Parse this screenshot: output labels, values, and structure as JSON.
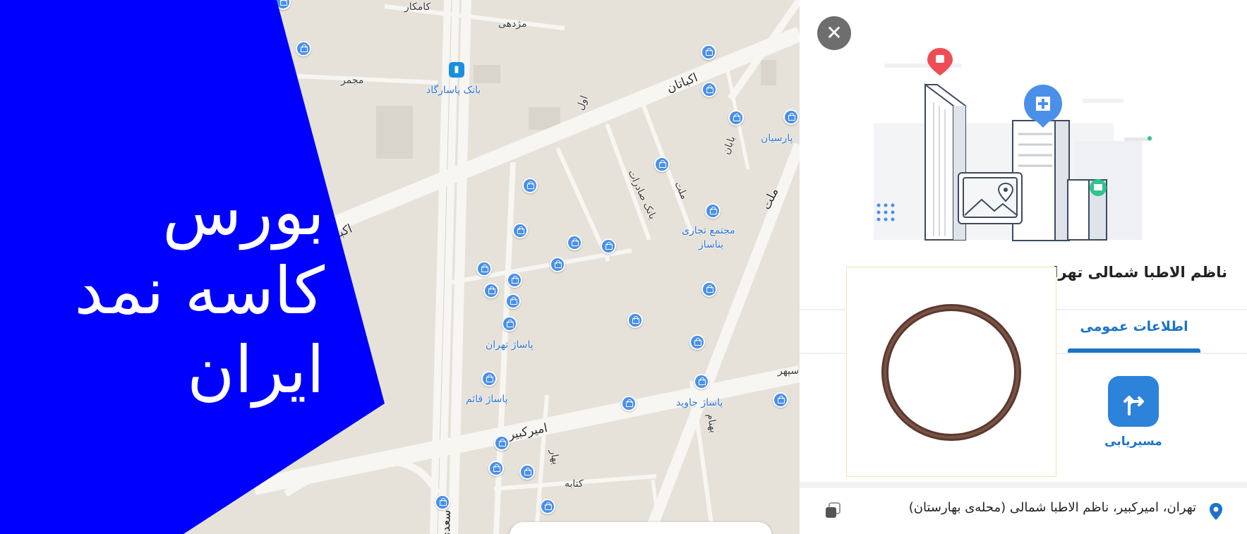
{
  "overlay": {
    "line1": "بورس",
    "line2": "کاسه نمد",
    "line3": "ایران",
    "color": "#0000ff"
  },
  "map": {
    "labels": {
      "kamkar": "کامکار",
      "mojdehi": "مژدهی",
      "mojammar": "مجمر",
      "bank_pasargad": "بانک پاسارگاد",
      "ekbatan_ne": "اکباتان",
      "ekbatan_w": "اکبا",
      "aval": "اول",
      "bank_saderat": "بانک صادرات",
      "mellat_street": "ملت",
      "mellat_road": "ملت",
      "babaei": "بابان",
      "parsian": "پارسیان",
      "mojtama_tejari": "مجتمع تجاری",
      "banasaz": "بناساز",
      "pasaj_tehran": "پاساژ تهران",
      "pasaj_ghaem": "پاساژ قائم",
      "pasaj_javid": "پاساژ جاوید",
      "amirkabir": "امیرکبیر",
      "bahar": "بهار",
      "behnam": "بهنام",
      "ketabeh": "کتابه",
      "sepehr": "سپهر",
      "saadi": "سعدی"
    },
    "bus_icon": "bus-stop-icon",
    "pin_icon": "location-pin-icon",
    "shop_icon": "shopping-bag-icon"
  },
  "panel": {
    "close_icon": "close-icon",
    "close_symbol": "✕",
    "title": "ناظم الاطبا شمالی تهران",
    "tab_general": "اطلاعات عمومی",
    "route_label": "مسیریابی",
    "route_icon": "directions-icon",
    "address": "تهران، امیرکبیر، ناظم الاطبا شمالی (محله‌ی بهارستان)",
    "address_icon": "location-icon",
    "copy_icon": "copy-icon",
    "accent": "#1b73c8"
  }
}
